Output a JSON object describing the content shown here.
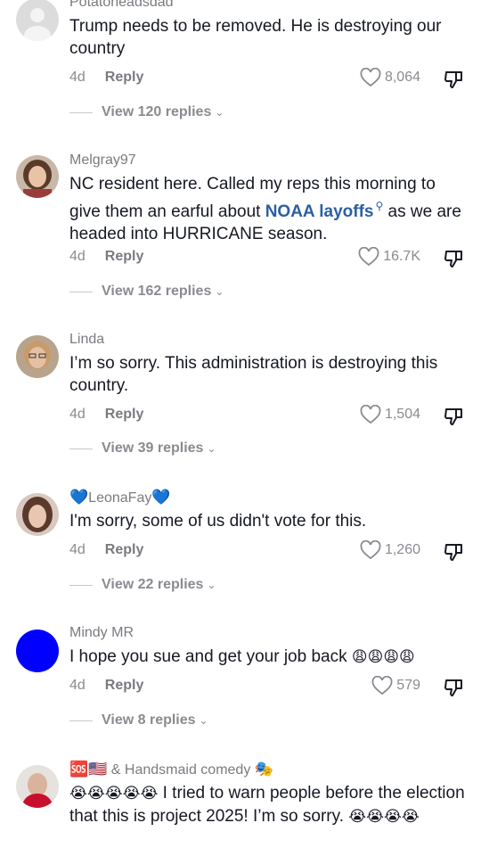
{
  "comments": [
    {
      "username": "Potatoheadsdad",
      "text": "Trump needs to be removed. He is destroying our country",
      "age": "4d",
      "reply_label": "Reply",
      "likes": "8,064",
      "view_replies": "View 120 replies",
      "avatar_color": "#dcdcdc"
    },
    {
      "username": "Melgray97",
      "text_before": "NC resident here. Called my reps this morning to give them an earful about ",
      "text_link": "NOAA layoffs",
      "text_after": " as we are headed into HURRICANE season.",
      "age": "4d",
      "reply_label": "Reply",
      "likes": "16.7K",
      "view_replies": "View 162 replies"
    },
    {
      "username": "Linda",
      "text": "I’m so sorry. This administration is destroying this country.",
      "age": "4d",
      "reply_label": "Reply",
      "likes": "1,504",
      "view_replies": "View 39 replies"
    },
    {
      "username_prefix": "💙",
      "username": "LeonaFay",
      "username_suffix": "💙",
      "text": "I'm sorry, some of us didn't vote for this.",
      "age": "4d",
      "reply_label": "Reply",
      "likes": "1,260",
      "view_replies": "View 22 replies"
    },
    {
      "username": "Mindy MR",
      "text": "I hope you sue and get your job back",
      "text_emoji": "😩😩😩😩",
      "age": "4d",
      "reply_label": "Reply",
      "likes": "579",
      "view_replies": "View 8 replies",
      "avatar_color": "#0000ff"
    },
    {
      "username_prefix": "🆘🇺🇸",
      "username": "& Handsmaid comedy",
      "username_suffix": "🎭",
      "text_emoji_lead": "😭😭😭😭😭",
      "text": " I tried to warn people before the election that this is project 2025! I’m so sorry. ",
      "text_emoji_tail": "😭😭😭😭"
    }
  ],
  "colors": {
    "link": "#2b5fa3",
    "meta": "#8a8b91",
    "text": "#161823"
  }
}
